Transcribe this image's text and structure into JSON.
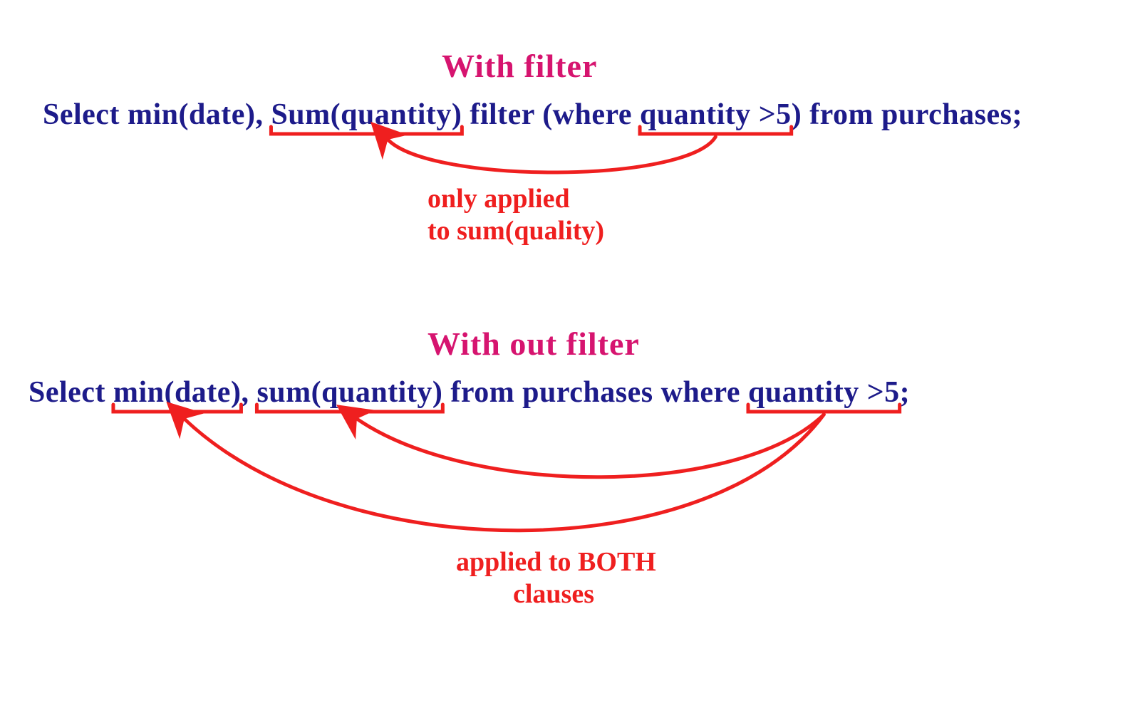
{
  "colors": {
    "pink": "#d6146f",
    "navy": "#1d1b8a",
    "red": "#ef1f1f"
  },
  "top": {
    "title": "With  filter",
    "sql": {
      "select": "Select ",
      "min": "min(date)",
      "comma": ", ",
      "sum": "Sum(quantity)",
      "filter_kw": " filter ",
      "where_open": "(where ",
      "cond": "quantity >5",
      "where_close": ")",
      "from": " from purchases;"
    },
    "annotation_line1": "only applied",
    "annotation_line2": "to sum(quality)"
  },
  "bottom": {
    "title": "With out  filter",
    "sql": {
      "select": "Select ",
      "min": "min(date)",
      "comma": ", ",
      "sum": "sum(quantity)",
      "from": " from purchases  ",
      "where_kw": "where ",
      "cond": "quantity >5",
      "semi": ";"
    },
    "annotation_line1": "applied to BOTH",
    "annotation_line2": "clauses"
  }
}
